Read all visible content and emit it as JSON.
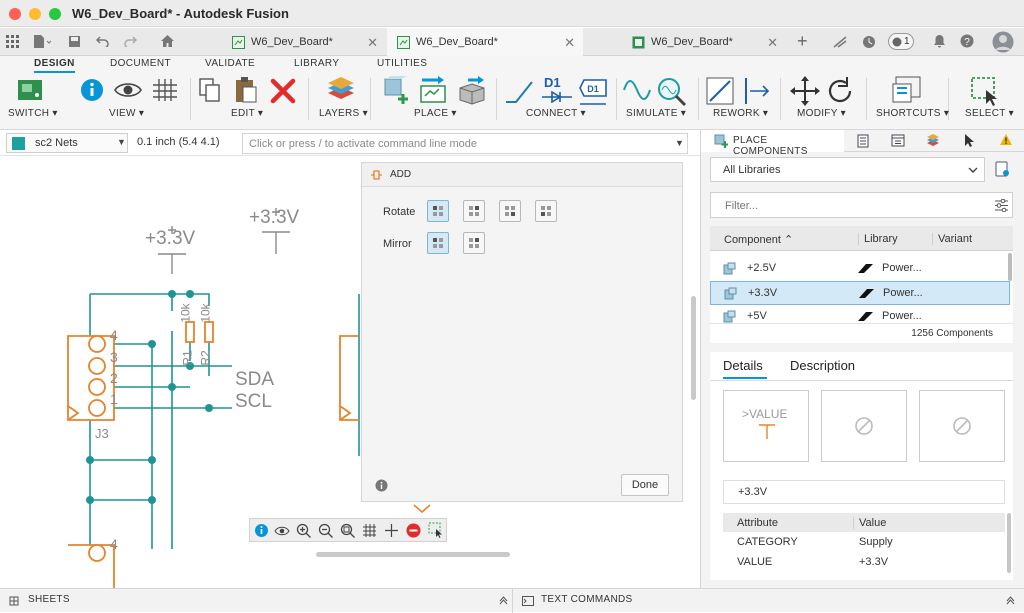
{
  "window": {
    "title": "W6_Dev_Board* - Autodesk Fusion"
  },
  "doc_tabs": [
    {
      "label": "W6_Dev_Board*"
    },
    {
      "label": "W6_Dev_Board*"
    },
    {
      "label": "W6_Dev_Board*"
    }
  ],
  "notifications": {
    "count": "1"
  },
  "ribbon": {
    "tabs": [
      "DESIGN",
      "DOCUMENT",
      "VALIDATE",
      "LIBRARY",
      "UTILITIES"
    ],
    "groups": [
      "SWITCH",
      "VIEW",
      "EDIT",
      "LAYERS",
      "PLACE",
      "CONNECT",
      "SIMULATE",
      "REWORK",
      "MODIFY",
      "SHORTCUTS",
      "SELECT"
    ],
    "d1_label": "D1"
  },
  "command_row": {
    "net_class": "sc2 Nets",
    "grid": "0.1 inch (5.4 4.1)",
    "cmd_placeholder": "Click or press / to activate command line mode"
  },
  "add_panel": {
    "title": "ADD",
    "rotate_label": "Rotate",
    "mirror_label": "Mirror",
    "done_label": "Done"
  },
  "schematic": {
    "labels": {
      "p33a": "+3.3V",
      "p33b": "+3.3V",
      "sda": "SDA",
      "scl": "SCL",
      "j3": "J3",
      "r1": "R1",
      "r2": "R2",
      "r1v": "10k",
      "r2v": "10k",
      "pin4": "4",
      "pin3": "3",
      "pin2": "2",
      "pin1": "1",
      "pin4b": "4"
    }
  },
  "right_panel": {
    "title": "PLACE COMPONENTS",
    "library_select": "All Libraries",
    "filter_placeholder": "Filter...",
    "columns": [
      "Component",
      "Library",
      "Variant"
    ],
    "rows": [
      {
        "component": "+2.5V",
        "library": "Power..."
      },
      {
        "component": "+3.3V",
        "library": "Power..."
      },
      {
        "component": "+5V",
        "library": "Power..."
      }
    ],
    "count": "1256 Components",
    "detail_tabs": [
      "Details",
      "Description"
    ],
    "preview_value": ">VALUE",
    "selected_name": "+3.3V",
    "attr_columns": [
      "Attribute",
      "Value"
    ],
    "attributes": [
      {
        "name": "CATEGORY",
        "value": "Supply"
      },
      {
        "name": "VALUE",
        "value": "+3.3V"
      }
    ]
  },
  "bottom": {
    "sheets": "SHEETS",
    "text_commands": "TEXT COMMANDS"
  },
  "colors": {
    "accent": "#0696d7",
    "wire": "#1f9494",
    "part": "#e8822b",
    "label": "#8a8a8a",
    "selected_row": "#d4e9f7"
  }
}
